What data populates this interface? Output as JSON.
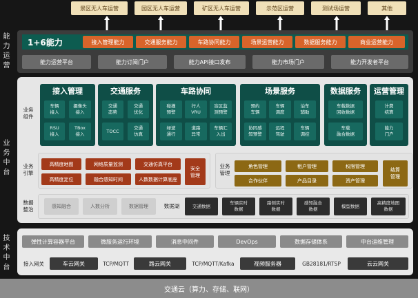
{
  "scenarios": [
    "景区无人车运营",
    "园区无人车运营",
    "矿区无人车运营",
    "示范区运营",
    "测试场运营",
    "其他"
  ],
  "side_labels": {
    "capability": [
      "能",
      "力",
      "运",
      "营"
    ],
    "business": [
      "业",
      "务",
      "中",
      "台"
    ],
    "tech": [
      "技",
      "术",
      "中",
      "台"
    ]
  },
  "capability": {
    "title": "1+6能力",
    "items": [
      "接入管理能力",
      "交通服务能力",
      "车路协同能力",
      "场景运营能力",
      "数据服务能力",
      "商业运营能力"
    ],
    "platforms": [
      "能力运营平台",
      "能力订阅门户",
      "能力API接口发布",
      "能力市场门户",
      "能力开发者平台"
    ]
  },
  "business_components": {
    "label": "业务\n组件",
    "groups": [
      {
        "title": "接入管理",
        "cells": [
          "车辆\n接入",
          "摄像头\n接入",
          "RSU\n接入",
          "TBox\n接入"
        ]
      },
      {
        "title": "交通服务",
        "cells": [
          "交通\n态势",
          "交通\n优化",
          "TOCC",
          "交通\n仿真"
        ]
      },
      {
        "title": "车路协同",
        "cells": [
          "碰撞\n预警",
          "行人\nVRU",
          "盲区监\n测预警",
          "绿波\n通行",
          "道路\n异常",
          "车辆汇\n入出"
        ]
      },
      {
        "title": "场景服务",
        "cells": [
          "预约\n车辆",
          "车辆\n调度",
          "泊车\n辅助",
          "协同感\n知预警",
          "远程\n驾驶",
          "车辆\n调控"
        ]
      },
      {
        "title": "数据服务",
        "cells": [
          "车载数据\n回收数据",
          "车载\n融合数据"
        ]
      },
      {
        "title": "运营管理",
        "cells": [
          "计费\n结算",
          "能力\n门户"
        ]
      }
    ]
  },
  "business_engine": {
    "label": "业务\n引擎",
    "items": [
      "高精度地图",
      "网络质量监测",
      "交通仿真平台",
      "高精度定位",
      "融合感知时间",
      "人数数据计算底座"
    ],
    "security": "安全\n管理"
  },
  "business_mgmt": {
    "label": "业务\n管理",
    "items": [
      "角色管理",
      "租户管理",
      "权限管理",
      "合作伙伴",
      "产品目录",
      "资产管理"
    ],
    "settlement": "结算\n管理"
  },
  "data_gov": {
    "label": "数据\n整治",
    "items": [
      "感知融合",
      "人数分析",
      "数据管理"
    ],
    "lake_label": "数据湖",
    "lake_items": [
      "交通数据",
      "车辆实时\n数据",
      "路侧实时\n数据",
      "感知融合\n数据",
      "模型数据",
      "高精度地图\n数据"
    ]
  },
  "tech": {
    "items": [
      "弹性计算容器平台",
      "微服务运行环境",
      "消息中间件",
      "DevOps",
      "数据存储体系",
      "中台运维管理"
    ],
    "gateway_label": "接入网关",
    "gateways": [
      "车云网关",
      "路云网关",
      "视频服务器",
      "云云网关"
    ],
    "protocols": [
      "TCP/MQTT",
      "TCP/MQTT/Kafka",
      "GB28181/RTSP"
    ]
  },
  "cloud": "交通云（算力、存储、联网）"
}
